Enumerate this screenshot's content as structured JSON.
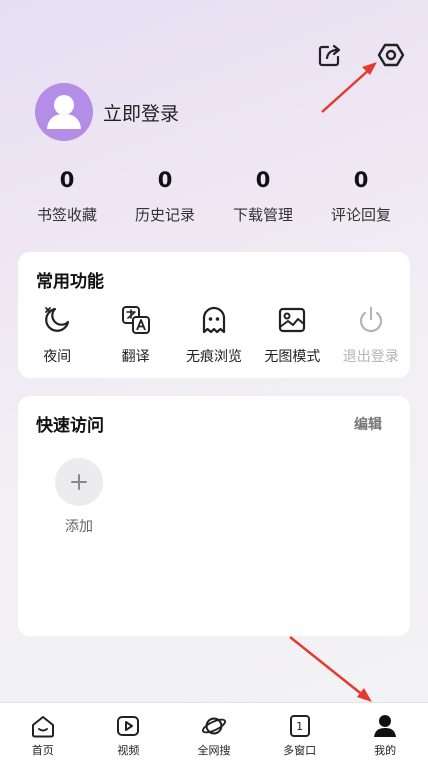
{
  "header": {
    "share_icon": "share-icon",
    "settings_icon": "settings-icon"
  },
  "profile": {
    "login_text": "立即登录"
  },
  "stats": [
    {
      "count": "0",
      "label": "书签收藏"
    },
    {
      "count": "0",
      "label": "历史记录"
    },
    {
      "count": "0",
      "label": "下载管理"
    },
    {
      "count": "0",
      "label": "评论回复"
    }
  ],
  "common_tools": {
    "title": "常用功能",
    "items": [
      {
        "label": "夜间",
        "icon": "moon-icon"
      },
      {
        "label": "翻译",
        "icon": "translate-icon"
      },
      {
        "label": "无痕浏览",
        "icon": "ghost-icon"
      },
      {
        "label": "无图模式",
        "icon": "image-icon"
      },
      {
        "label": "退出登录",
        "icon": "power-icon"
      }
    ]
  },
  "quick_access": {
    "title": "快速访问",
    "edit_label": "编辑",
    "add_label": "添加"
  },
  "bottom_nav": [
    {
      "label": "首页",
      "icon": "home-icon"
    },
    {
      "label": "视频",
      "icon": "video-icon"
    },
    {
      "label": "全网搜",
      "icon": "planet-icon"
    },
    {
      "label": "多窗口",
      "icon": "windows-icon",
      "badge": "1"
    },
    {
      "label": "我的",
      "icon": "user-icon"
    }
  ],
  "colors": {
    "avatar_bg": "#b48de6",
    "annotation_arrow": "#e53b2e",
    "disabled_text": "#b4b4b4"
  }
}
